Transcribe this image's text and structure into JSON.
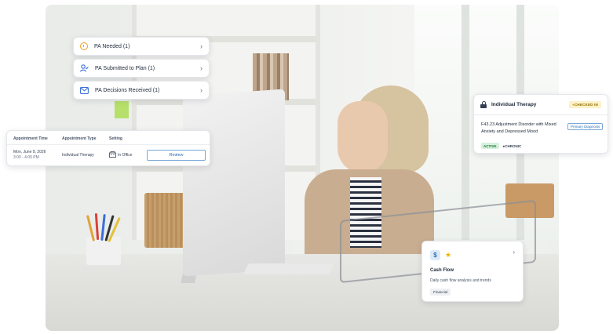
{
  "alerts": [
    {
      "label": "PA Needed (1)",
      "icon": "clock-icon",
      "chevron": "›"
    },
    {
      "label": "PA Submitted to Plan (1)",
      "icon": "user-check-icon",
      "chevron": "›"
    },
    {
      "label": "PA Decisions Received (1)",
      "icon": "mail-icon",
      "chevron": "›"
    }
  ],
  "appointment": {
    "headers": {
      "time": "Appointment Time",
      "type": "Appointment Type",
      "setting": "Setting"
    },
    "row": {
      "date": "Mon, June 9, 2026",
      "time_range": "3:00 - 4:00 PM",
      "type": "Individual Therapy",
      "setting": "In Office",
      "setting_icon": "building-icon",
      "review_label": "Review",
      "review_chevron": "›"
    }
  },
  "therapy_card": {
    "title": "Individual Therapy",
    "status_badge": "CHECKED IN",
    "diagnosis": "F43.23 Adjustment Disorder with Mixed Anxiety and Depressed Mood",
    "primary_label": "Primary Diagnosis",
    "active_label": "ACTIVE",
    "chronic_label": "CHRONIC"
  },
  "cash_card": {
    "icon_symbol": "$",
    "star": "★",
    "chevron": "›",
    "title": "Cash Flow",
    "description": "Daily cash flow analysis and trends",
    "tag": "Financial"
  },
  "colors": {
    "accent_blue": "#2f6db5",
    "warning": "#f0a020",
    "active_green": "#1b7a3a",
    "checked_in_bg": "#fdf2c8"
  }
}
